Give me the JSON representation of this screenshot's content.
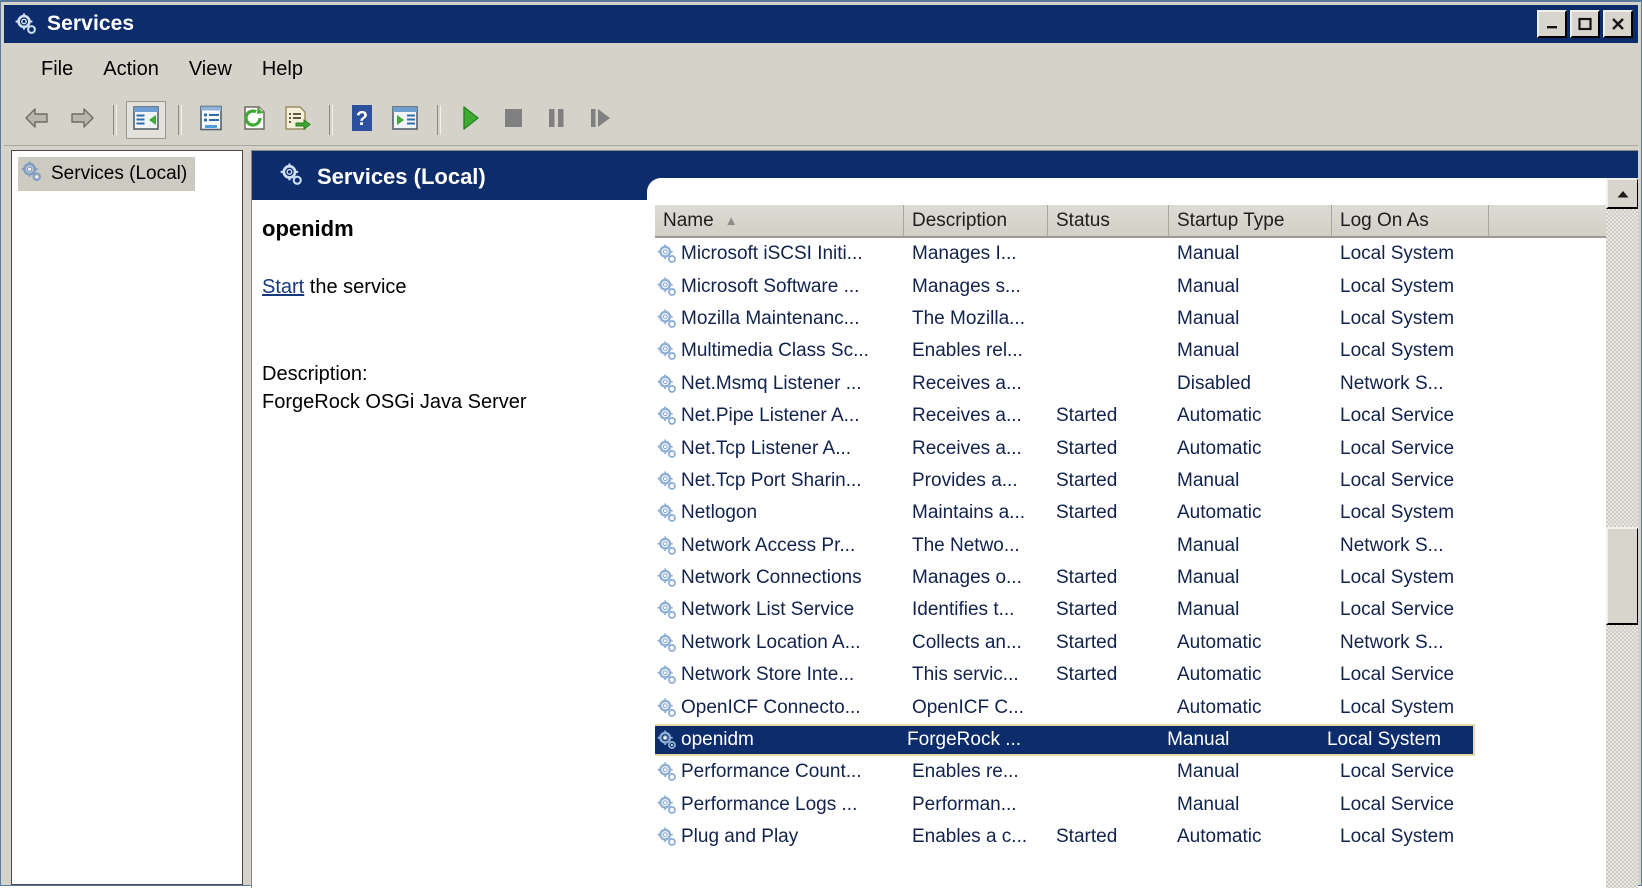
{
  "window": {
    "title": "Services",
    "title_icon": "services-gear-icon",
    "controls": {
      "minimize": "Minimize",
      "maximize": "Maximize",
      "close": "Close"
    }
  },
  "menu": {
    "items": [
      {
        "label": "File"
      },
      {
        "label": "Action"
      },
      {
        "label": "View"
      },
      {
        "label": "Help"
      }
    ]
  },
  "toolbar": {
    "buttons": [
      {
        "name": "back-button",
        "icon": "arrow-left-icon",
        "enabled": true
      },
      {
        "name": "forward-button",
        "icon": "arrow-right-icon",
        "enabled": true
      },
      {
        "name": "show-hide-tree-button",
        "icon": "tree-pane-icon",
        "enabled": true,
        "pressed": true
      },
      {
        "name": "properties-button",
        "icon": "properties-icon",
        "enabled": true
      },
      {
        "name": "refresh-button",
        "icon": "refresh-icon",
        "enabled": true
      },
      {
        "name": "export-list-button",
        "icon": "export-list-icon",
        "enabled": true
      },
      {
        "name": "help-button",
        "icon": "question-mark-icon",
        "enabled": true
      },
      {
        "name": "show-hide-action-pane-button",
        "icon": "action-pane-icon",
        "enabled": true
      },
      {
        "name": "start-service-button",
        "icon": "play-icon",
        "enabled": true
      },
      {
        "name": "stop-service-button",
        "icon": "stop-icon",
        "enabled": false
      },
      {
        "name": "pause-service-button",
        "icon": "pause-icon",
        "enabled": false
      },
      {
        "name": "restart-service-button",
        "icon": "restart-icon",
        "enabled": false
      }
    ]
  },
  "tree": {
    "root_label": "Services (Local)",
    "root_icon": "services-gear-icon"
  },
  "banner": {
    "label": "Services (Local)",
    "icon": "services-gear-icon"
  },
  "details": {
    "service_name": "openidm",
    "action_link": "Start",
    "action_suffix": " the service",
    "description_label": "Description:",
    "description_text": "ForgeRock OSGi Java Server"
  },
  "list": {
    "columns": [
      {
        "label": "Name",
        "sorted": "ascending",
        "sort_glyph": "▲"
      },
      {
        "label": "Description"
      },
      {
        "label": "Status"
      },
      {
        "label": "Startup Type"
      },
      {
        "label": "Log On As"
      }
    ],
    "rows": [
      {
        "name": "Microsoft iSCSI Initi...",
        "description": "Manages I...",
        "status": "",
        "startup": "Manual",
        "logon": "Local System",
        "selected": false
      },
      {
        "name": "Microsoft Software ...",
        "description": "Manages s...",
        "status": "",
        "startup": "Manual",
        "logon": "Local System",
        "selected": false
      },
      {
        "name": "Mozilla Maintenanc...",
        "description": "The Mozilla...",
        "status": "",
        "startup": "Manual",
        "logon": "Local System",
        "selected": false
      },
      {
        "name": "Multimedia Class Sc...",
        "description": "Enables rel...",
        "status": "",
        "startup": "Manual",
        "logon": "Local System",
        "selected": false
      },
      {
        "name": "Net.Msmq Listener ...",
        "description": "Receives a...",
        "status": "",
        "startup": "Disabled",
        "logon": "Network S...",
        "selected": false
      },
      {
        "name": "Net.Pipe Listener A...",
        "description": "Receives a...",
        "status": "Started",
        "startup": "Automatic",
        "logon": "Local Service",
        "selected": false
      },
      {
        "name": "Net.Tcp Listener A...",
        "description": "Receives a...",
        "status": "Started",
        "startup": "Automatic",
        "logon": "Local Service",
        "selected": false
      },
      {
        "name": "Net.Tcp Port Sharin...",
        "description": "Provides a...",
        "status": "Started",
        "startup": "Manual",
        "logon": "Local Service",
        "selected": false
      },
      {
        "name": "Netlogon",
        "description": "Maintains a...",
        "status": "Started",
        "startup": "Automatic",
        "logon": "Local System",
        "selected": false
      },
      {
        "name": "Network Access Pr...",
        "description": "The Netwo...",
        "status": "",
        "startup": "Manual",
        "logon": "Network S...",
        "selected": false
      },
      {
        "name": "Network Connections",
        "description": "Manages o...",
        "status": "Started",
        "startup": "Manual",
        "logon": "Local System",
        "selected": false
      },
      {
        "name": "Network List Service",
        "description": "Identifies t...",
        "status": "Started",
        "startup": "Manual",
        "logon": "Local Service",
        "selected": false
      },
      {
        "name": "Network Location A...",
        "description": "Collects an...",
        "status": "Started",
        "startup": "Automatic",
        "logon": "Network S...",
        "selected": false
      },
      {
        "name": "Network Store Inte...",
        "description": "This servic...",
        "status": "Started",
        "startup": "Automatic",
        "logon": "Local Service",
        "selected": false
      },
      {
        "name": "OpenICF Connecto...",
        "description": "OpenICF C...",
        "status": "",
        "startup": "Automatic",
        "logon": "Local System",
        "selected": false
      },
      {
        "name": "openidm",
        "description": "ForgeRock ...",
        "status": "",
        "startup": "Manual",
        "logon": "Local System",
        "selected": true
      },
      {
        "name": "Performance Count...",
        "description": "Enables re...",
        "status": "",
        "startup": "Manual",
        "logon": "Local Service",
        "selected": false
      },
      {
        "name": "Performance Logs ...",
        "description": "Performan...",
        "status": "",
        "startup": "Manual",
        "logon": "Local Service",
        "selected": false
      },
      {
        "name": "Plug and Play",
        "description": "Enables a c...",
        "status": "Started",
        "startup": "Automatic",
        "logon": "Local System",
        "selected": false
      }
    ],
    "scrollbar": {
      "up_arrow": "▲"
    }
  },
  "colors": {
    "title_bar": "#0d2c6b",
    "banner": "#0d2c6b",
    "selection": "#0d2c6b",
    "selection_border": "#e8d9a8",
    "chrome": "#d5d2ca",
    "link": "#16387d",
    "start_icon": "#3caa2e",
    "disabled_icon": "#808080",
    "row_text": "#11224d"
  }
}
